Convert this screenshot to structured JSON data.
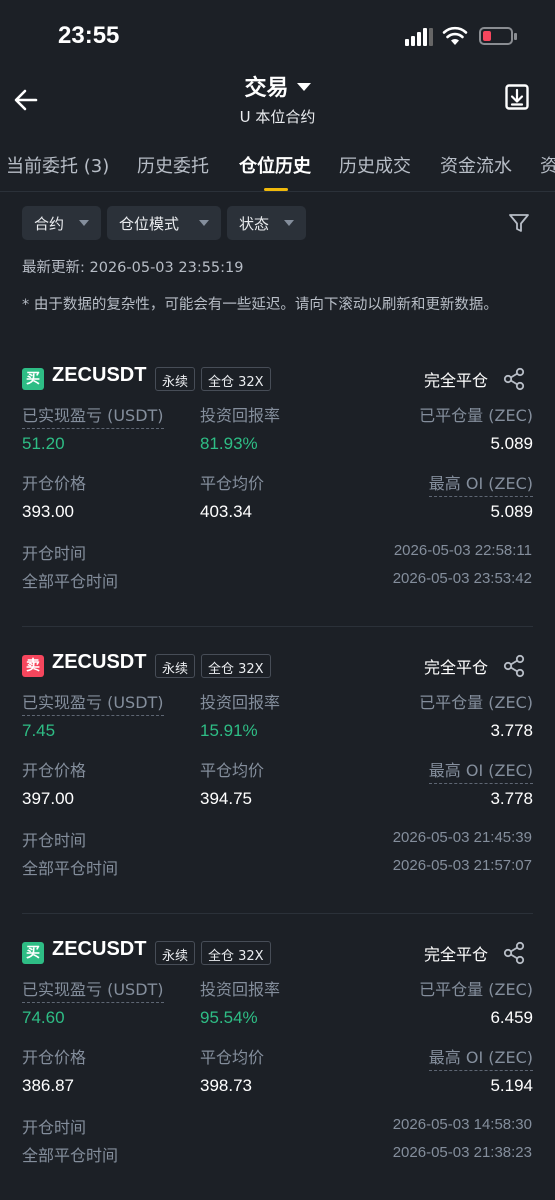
{
  "status_bar": {
    "time": "23:55"
  },
  "header": {
    "title": "交易",
    "subtitle": "U 本位合约"
  },
  "tabs": [
    {
      "label": "当前委托 (3)"
    },
    {
      "label": "历史委托"
    },
    {
      "label": "仓位历史",
      "active": true
    },
    {
      "label": "历史成交"
    },
    {
      "label": "资金流水"
    },
    {
      "label": "资"
    }
  ],
  "filters": [
    {
      "label": "合约"
    },
    {
      "label": "仓位模式"
    },
    {
      "label": "状态"
    }
  ],
  "last_updated": "最新更新: 2026-05-03 23:55:19",
  "note": "* 由于数据的复杂性，可能会有一些延迟。请向下滚动以刷新和更新数据。",
  "labels": {
    "pnl": "已实现盈亏 (USDT)",
    "roi": "投资回报率",
    "closed_qty": "已平仓量 (ZEC)",
    "open_price": "开仓价格",
    "close_avg": "平仓均价",
    "max_oi": "最高 OI (ZEC)",
    "open_time": "开仓时间",
    "close_time": "全部平仓时间"
  },
  "positions": [
    {
      "side": "买",
      "side_type": "buy",
      "symbol": "ZECUSDT",
      "perp_tag": "永续",
      "margin_tag": "全仓 32X",
      "status": "完全平仓",
      "pnl": "51.20",
      "roi": "81.93%",
      "closed_qty": "5.089",
      "open_price": "393.00",
      "close_avg": "403.34",
      "max_oi": "5.089",
      "open_time": "2026-05-03 22:58:11",
      "close_time": "2026-05-03 23:53:42"
    },
    {
      "side": "卖",
      "side_type": "sell",
      "symbol": "ZECUSDT",
      "perp_tag": "永续",
      "margin_tag": "全仓 32X",
      "status": "完全平仓",
      "pnl": "7.45",
      "roi": "15.91%",
      "closed_qty": "3.778",
      "open_price": "397.00",
      "close_avg": "394.75",
      "max_oi": "3.778",
      "open_time": "2026-05-03 21:45:39",
      "close_time": "2026-05-03 21:57:07"
    },
    {
      "side": "买",
      "side_type": "buy",
      "symbol": "ZECUSDT",
      "perp_tag": "永续",
      "margin_tag": "全仓 32X",
      "status": "完全平仓",
      "pnl": "74.60",
      "roi": "95.54%",
      "closed_qty": "6.459",
      "open_price": "386.87",
      "close_avg": "398.73",
      "max_oi": "5.194",
      "open_time": "2026-05-03 14:58:30",
      "close_time": "2026-05-03 21:38:23"
    }
  ],
  "colors": {
    "background": "#1c2026",
    "profit_green": "#2ebd85",
    "sell_red": "#f6465d",
    "accent_yellow": "#f0b90b"
  },
  "icons": [
    "back-arrow-icon",
    "dropdown-caret-icon",
    "download-icon",
    "filter-funnel-icon",
    "share-icon",
    "wifi-icon",
    "battery-icon",
    "signal-icon"
  ]
}
